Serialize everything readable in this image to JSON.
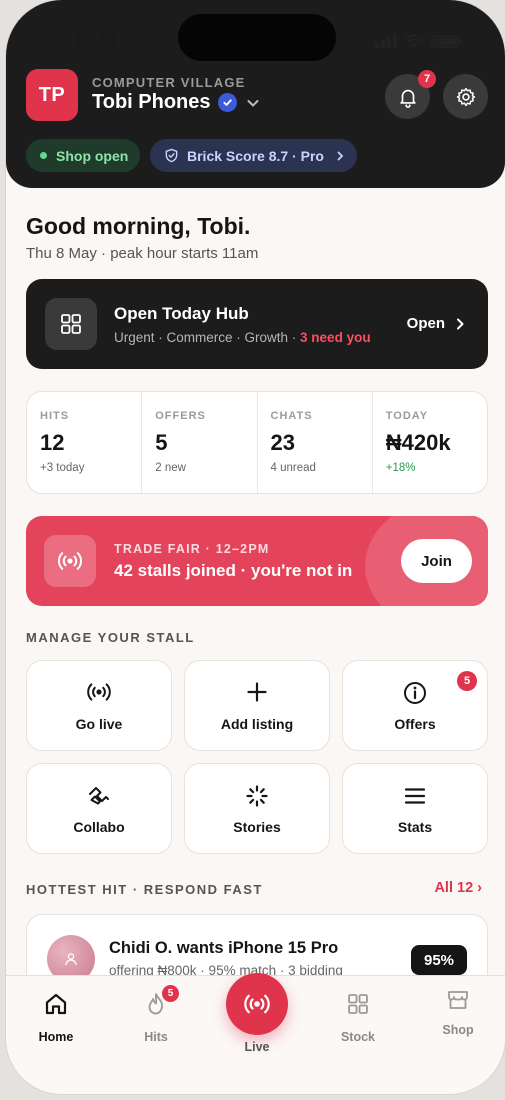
{
  "status_bar": {
    "time": "9:41"
  },
  "header": {
    "avatar_initials": "TP",
    "shop_subtitle": "COMPUTER VILLAGE",
    "shop_name": "Tobi Phones",
    "notification_count": "7",
    "shop_status": "Shop open",
    "brick_score": "Brick Score 8.7 · Pro"
  },
  "greeting": {
    "title": "Good morning, Tobi.",
    "subtitle": "Thu 8 May · peak hour starts 11am"
  },
  "today_hub": {
    "title": "Open Today Hub",
    "subtitle": "Urgent · Commerce · Growth · ",
    "need": "3 need you",
    "action": "Open"
  },
  "stats": [
    {
      "label": "HITS",
      "value": "12",
      "sub": "+3 today"
    },
    {
      "label": "OFFERS",
      "value": "5",
      "sub": "2 new"
    },
    {
      "label": "CHATS",
      "value": "23",
      "sub": "4 unread"
    },
    {
      "label": "TODAY",
      "value": "₦420k",
      "sub": "+18%"
    }
  ],
  "trade_fair": {
    "kicker": "TRADE FAIR · 12–2PM",
    "title": "42 stalls joined · you're not in",
    "action": "Join"
  },
  "manage": {
    "heading": "MANAGE YOUR STALL",
    "tiles": [
      {
        "label": "Go live",
        "icon": "broadcast-icon"
      },
      {
        "label": "Add listing",
        "icon": "plus-icon"
      },
      {
        "label": "Offers",
        "icon": "info-icon",
        "badge": "5"
      },
      {
        "label": "Collabo",
        "icon": "handshake-icon"
      },
      {
        "label": "Stories",
        "icon": "loader-icon"
      },
      {
        "label": "Stats",
        "icon": "menu-icon"
      }
    ]
  },
  "hottest": {
    "heading": "HOTTEST HIT · RESPOND FAST",
    "all_link": "All 12 ›",
    "title": "Chidi O. wants iPhone 15 Pro",
    "subtitle": "offering ₦800k · 95% match · 3 bidding",
    "match": "95%"
  },
  "tabbar": {
    "tabs": [
      {
        "label": "Home",
        "icon": "home-icon",
        "active": true
      },
      {
        "label": "Hits",
        "icon": "flame-icon",
        "badge": "5"
      },
      {
        "label": "Live",
        "icon": "broadcast-icon"
      },
      {
        "label": "Stock",
        "icon": "grid-icon"
      },
      {
        "label": "Shop",
        "icon": "store-icon"
      }
    ]
  },
  "colors": {
    "accent": "#e0344d",
    "dark": "#1c1c1d",
    "shop_open_green": "#63d98b",
    "score_blue": "#2b3350"
  }
}
